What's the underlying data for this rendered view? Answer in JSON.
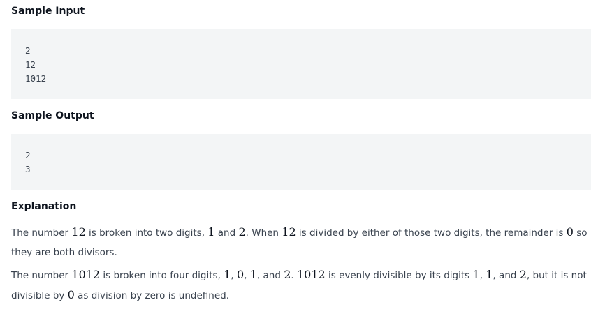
{
  "sample_input": {
    "heading": "Sample Input",
    "lines": [
      "2",
      "12",
      "1012"
    ]
  },
  "sample_output": {
    "heading": "Sample Output",
    "lines": [
      "2",
      "3"
    ]
  },
  "explanation": {
    "heading": "Explanation",
    "para1": {
      "t1": "The number ",
      "m1": "12",
      "t2": " is broken into two digits, ",
      "m2": "1",
      "t3": " and ",
      "m3": "2",
      "t4": ". When ",
      "m4": "12",
      "t5": " is divided by either of those two digits, the remainder is ",
      "m5": "0",
      "t6": " so they are both divisors."
    },
    "para2": {
      "t1": "The number ",
      "m1": "1012",
      "t2": " is broken into four digits, ",
      "m2": "1",
      "t3": ", ",
      "m3": "0",
      "t4": ", ",
      "m4": "1",
      "t5": ", and ",
      "m5": "2",
      "t6": ". ",
      "m6": "1012",
      "t7": " is evenly divisible by its digits ",
      "m7": "1",
      "t8": ", ",
      "m8": "1",
      "t9": ", and ",
      "m9": "2",
      "t10": ", but it is not divisible by ",
      "m10": "0",
      "t11": " as division by zero is undefined."
    }
  }
}
